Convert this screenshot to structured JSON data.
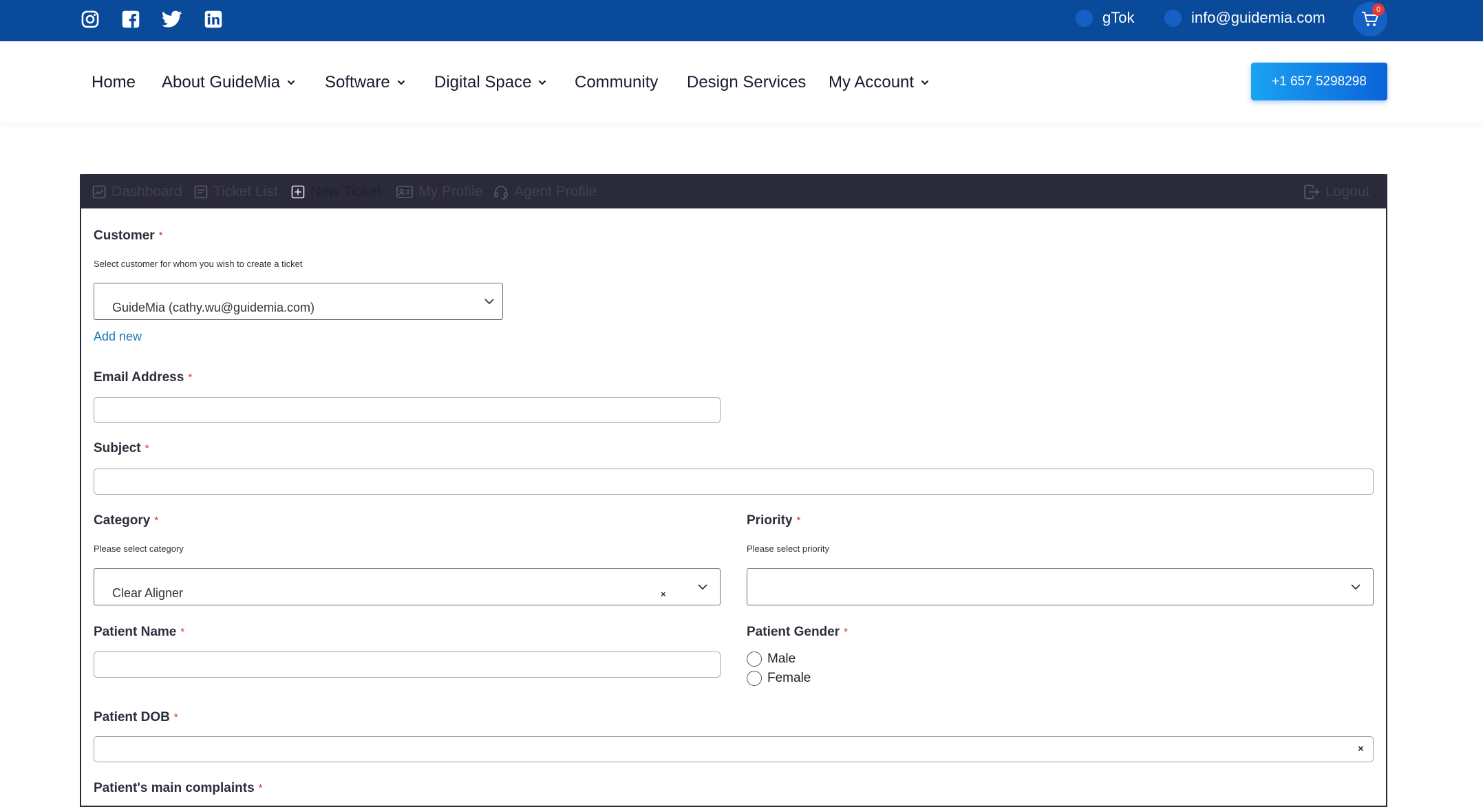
{
  "topbar": {
    "social_icons": [
      "instagram-icon",
      "facebook-icon",
      "twitter-icon",
      "linkedin-icon"
    ],
    "gtok_label": "gTok",
    "email": "info@guidemia.com",
    "cart_count": "0"
  },
  "nav": {
    "items": [
      {
        "label": "Home",
        "dropdown": false
      },
      {
        "label": "About GuideMia",
        "dropdown": true
      },
      {
        "label": "Software",
        "dropdown": true
      },
      {
        "label": "Digital Space",
        "dropdown": true
      },
      {
        "label": "Community",
        "dropdown": false
      },
      {
        "label": "Design Services",
        "dropdown": false
      },
      {
        "label": "My Account",
        "dropdown": true
      }
    ],
    "phone": "+1 657 5298298"
  },
  "tabs": {
    "dashboard": "Dashboard",
    "ticket_list": "Ticket List",
    "new_ticket": "New Ticket",
    "my_profile": "My Profile",
    "agent_profile": "Agent Profile",
    "logout": "Logout"
  },
  "form": {
    "required_mark": "*",
    "customer": {
      "label": "Customer",
      "hint": "Select customer for whom you wish to create a ticket",
      "value": "GuideMia (cathy.wu@guidemia.com)",
      "add_new": "Add new"
    },
    "email": {
      "label": "Email Address",
      "value": ""
    },
    "subject": {
      "label": "Subject",
      "value": ""
    },
    "category": {
      "label": "Category",
      "hint": "Please select category",
      "value": "Clear Aligner",
      "clear": "×"
    },
    "priority": {
      "label": "Priority",
      "hint": "Please select priority",
      "value": ""
    },
    "patient_name": {
      "label": "Patient Name",
      "value": ""
    },
    "patient_gender": {
      "label": "Patient Gender",
      "options": [
        "Male",
        "Female"
      ]
    },
    "patient_dob": {
      "label": "Patient DOB",
      "value": "",
      "clear": "×"
    },
    "complaints": {
      "label": "Patient's main complaints"
    }
  },
  "colors": {
    "topbar": "#0a4a9a",
    "tabbar": "#2b2a3a",
    "accent": "#0b63d8",
    "required": "#d32f2f",
    "link": "#1a7ab8"
  }
}
